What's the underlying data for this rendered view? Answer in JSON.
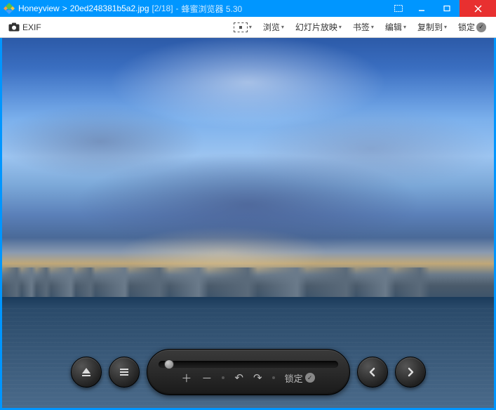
{
  "titlebar": {
    "app_name": "Honeyview",
    "separator": ">",
    "filename": "20ed248381b5a2.jpg",
    "position": "[2/18]",
    "dash": "-",
    "app_full": "蜂蜜浏览器 5.30"
  },
  "toolbar": {
    "exif_label": "EXIF",
    "browse": "浏览",
    "slideshow": "幻灯片放映",
    "bookmark": "书签",
    "edit": "编辑",
    "copy_to": "复制到",
    "lock": "锁定"
  },
  "controls": {
    "lock_label": "锁定"
  }
}
